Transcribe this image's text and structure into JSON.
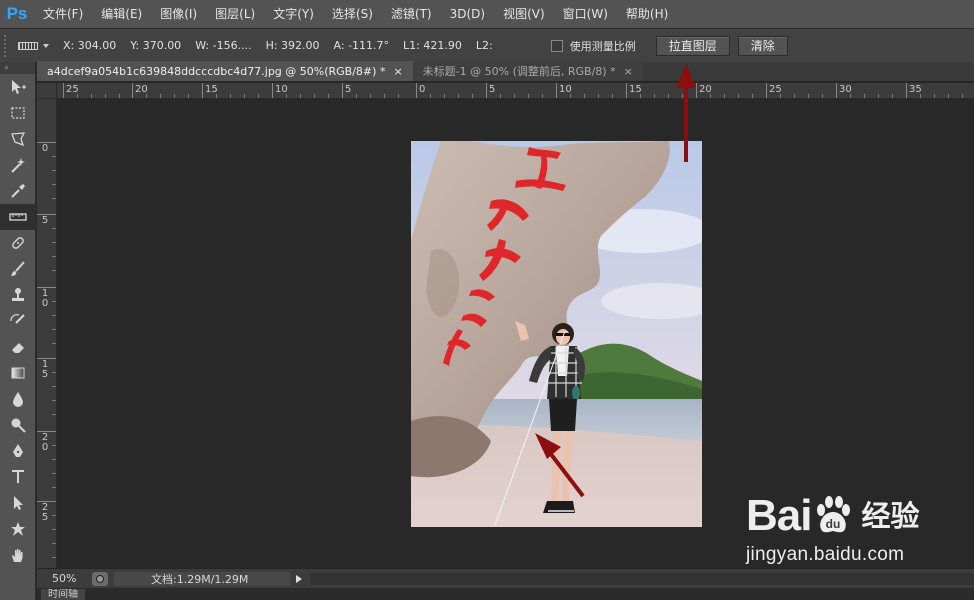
{
  "app": {
    "logo": "Ps"
  },
  "menu": [
    "文件(F)",
    "编辑(E)",
    "图像(I)",
    "图层(L)",
    "文字(Y)",
    "选择(S)",
    "滤镜(T)",
    "3D(D)",
    "视图(V)",
    "窗口(W)",
    "帮助(H)"
  ],
  "options": {
    "x": "X: 304.00",
    "y": "Y: 370.00",
    "w": "W: -156....",
    "h": "H: 392.00",
    "a": "A: -111.7°",
    "l1": "L1: 421.90",
    "l2": "L2:",
    "measure_scale_label": "使用测量比例",
    "measure_scale_checked": false,
    "straighten_button": "拉直图层",
    "clear_button": "清除"
  },
  "tools_header": "»",
  "tools": [
    "move-tool",
    "marquee-tool",
    "lasso-tool",
    "magic-wand-tool",
    "eyedropper-tool",
    "ruler-tool",
    "healing-brush-tool",
    "brush-tool",
    "clone-stamp-tool",
    "history-brush-tool",
    "eraser-tool",
    "gradient-tool",
    "blur-tool",
    "dodge-tool",
    "pen-tool",
    "type-tool",
    "path-selection-tool",
    "custom-shape-tool",
    "hand-tool"
  ],
  "active_tool": "ruler-tool",
  "tabs": [
    {
      "title": "a4dcef9a054b1c639848ddcccdbc4d77.jpg @ 50%(RGB/8#) *",
      "close": "×",
      "active": true
    },
    {
      "title": "未标题-1 @ 50% (调整前后, RGB/8) *",
      "close": "×",
      "active": false
    }
  ],
  "ruler_h_labels": [
    "25",
    "20",
    "15",
    "10",
    "5",
    "0",
    "5",
    "10",
    "15",
    "20",
    "25",
    "30",
    "35"
  ],
  "ruler_v_labels": [
    "0",
    "5",
    "10",
    "15",
    "20",
    "25"
  ],
  "image": {
    "calligraphy_color": "#e0262a",
    "arrow_color": "#8b0f0f"
  },
  "status": {
    "zoom": "50%",
    "doc_info": "文档:1.29M/1.29M"
  },
  "timeline": {
    "label": "时间轴"
  },
  "watermark": {
    "bai": "Bai",
    "du": "du",
    "jingyan": "经验",
    "url": "jingyan.baidu.com"
  }
}
